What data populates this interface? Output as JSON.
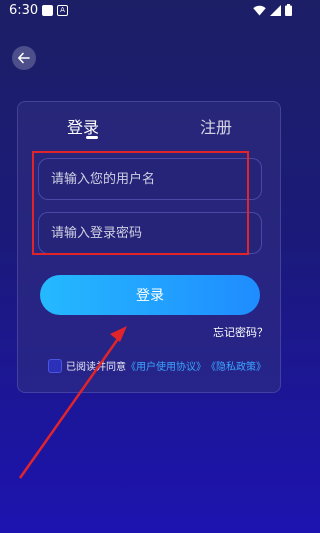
{
  "status_bar": {
    "time": "6:30",
    "notif_icon_b": "A"
  },
  "tabs": {
    "login": "登录",
    "register": "注册"
  },
  "form": {
    "username_placeholder": "请输入您的用户名",
    "password_placeholder": "请输入登录密码",
    "login_button": "登录",
    "forgot_password": "忘记密码？"
  },
  "agreement": {
    "prefix": "已阅读并同意",
    "terms": "《用户使用协议》",
    "privacy": "《隐私政策》"
  },
  "colors": {
    "accent_start": "#25b9ff",
    "accent_end": "#1f8cff",
    "annotation_red": "#e0242a",
    "link": "#39a6ff"
  },
  "icons": {
    "back": "arrow-left-icon",
    "wifi": "wifi-icon",
    "signal": "signal-icon",
    "battery": "battery-icon"
  }
}
